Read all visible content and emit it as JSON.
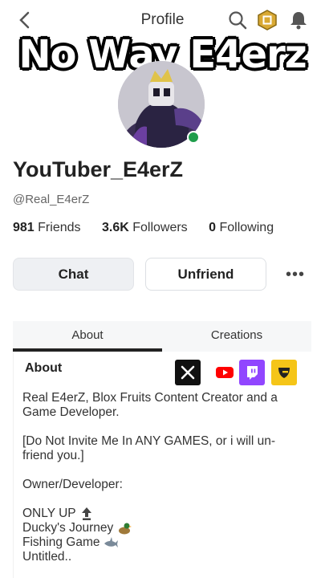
{
  "header": {
    "title": "Profile"
  },
  "overlay": {
    "text": "No Way E4erz"
  },
  "profile": {
    "display_name": "YouTuber_E4erZ",
    "username": "@Real_E4erZ",
    "stats": [
      {
        "count": "981",
        "label": "Friends"
      },
      {
        "count": "3.6K",
        "label": "Followers"
      },
      {
        "count": "0",
        "label": "Following"
      }
    ]
  },
  "actions": {
    "chat": "Chat",
    "unfriend": "Unfriend",
    "more": "•••"
  },
  "tabs": [
    {
      "label": "About"
    },
    {
      "label": "Creations"
    }
  ],
  "about": {
    "heading": "About",
    "socials": [
      "x-icon",
      "youtube-icon",
      "twitch-icon",
      "guilded-icon"
    ],
    "lines": {
      "l1": "Real E4erZ, Blox Fruits Content Creator and a Game Developer.",
      "l2": "[Do Not Invite Me In ANY GAMES, or i will un-friend you.]",
      "l3": "Owner/Developer:",
      "l4": "ONLY UP",
      "l5": "Ducky's Journey",
      "l6": "Fishing Game",
      "l7": "Untitled.."
    }
  },
  "colors": {
    "accent": "#222222",
    "online": "#1f9d4b",
    "twitch": "#9146ff",
    "guilded": "#f5c518",
    "youtube": "#ff0000"
  }
}
